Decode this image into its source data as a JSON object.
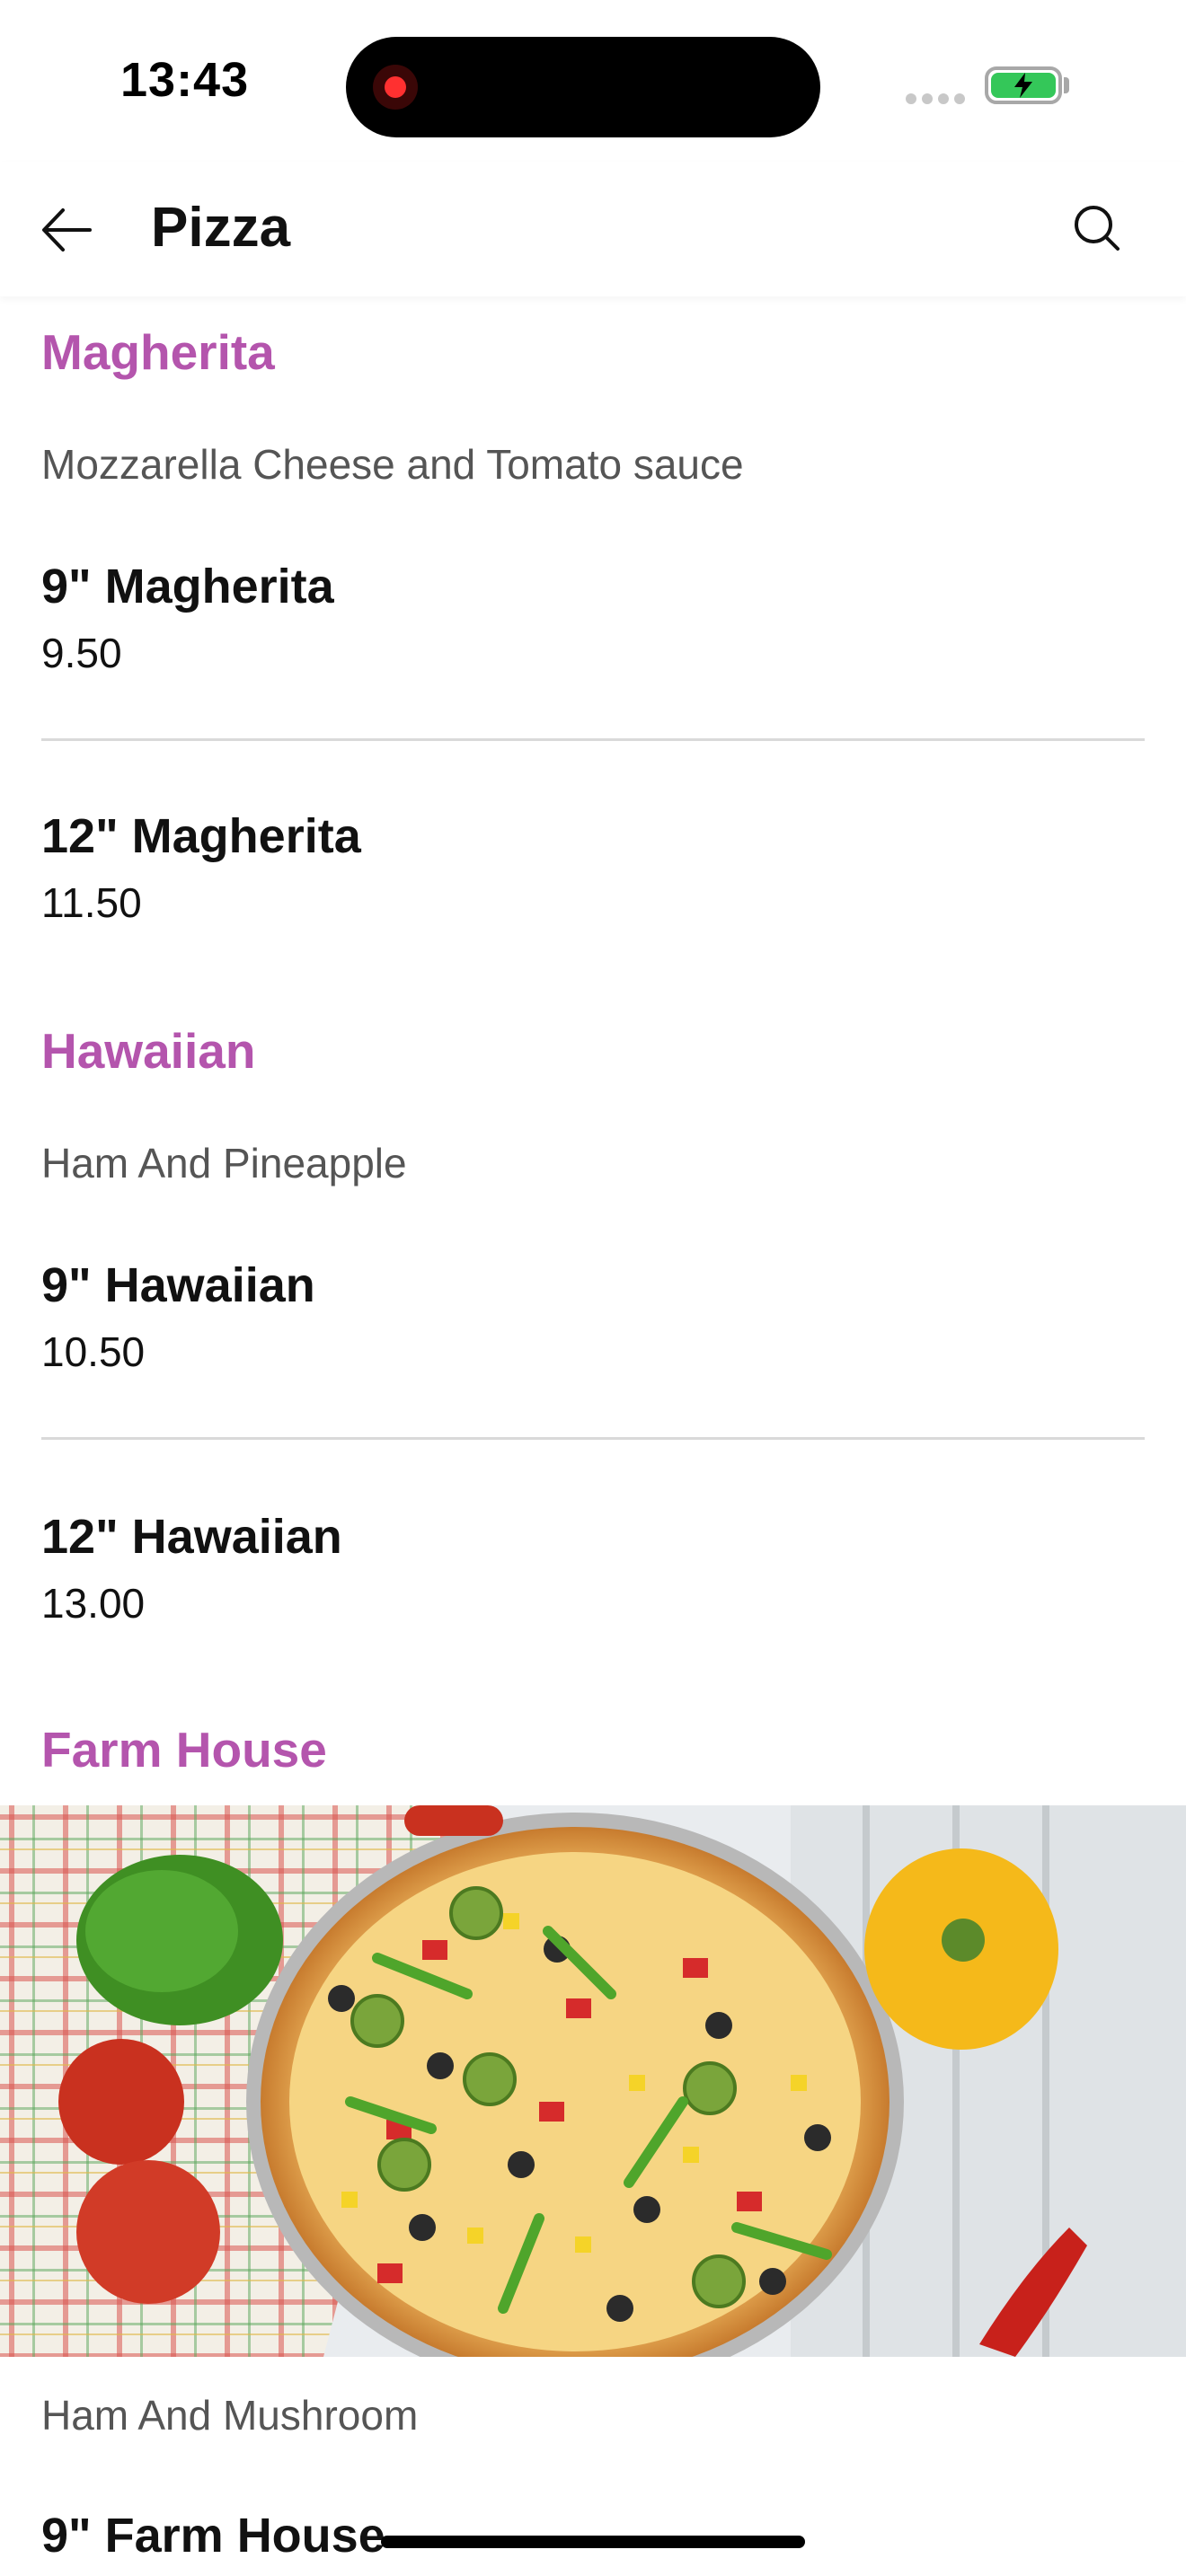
{
  "status": {
    "time": "13:43"
  },
  "header": {
    "title": "Pizza"
  },
  "menu": {
    "categories": [
      {
        "name": "Magherita",
        "description": "Mozzarella Cheese and Tomato sauce",
        "items": [
          {
            "name": "9\" Magherita",
            "price": "9.50"
          },
          {
            "name": "12\" Magherita",
            "price": "11.50"
          }
        ]
      },
      {
        "name": "Hawaiian",
        "description": "Ham And Pineapple",
        "items": [
          {
            "name": "9\" Hawaiian",
            "price": "10.50"
          },
          {
            "name": "12\" Hawaiian",
            "price": "13.00"
          }
        ]
      },
      {
        "name": "Farm House",
        "description": "Ham And Mushroom",
        "items": [
          {
            "name": "9\" Farm House"
          }
        ]
      }
    ]
  },
  "colors": {
    "accent": "#b455ad",
    "battery": "#34c759",
    "divider": "#d9d9d9"
  },
  "icons": {
    "back": "arrow-left-icon",
    "search": "search-icon",
    "battery": "battery-charging-icon"
  }
}
